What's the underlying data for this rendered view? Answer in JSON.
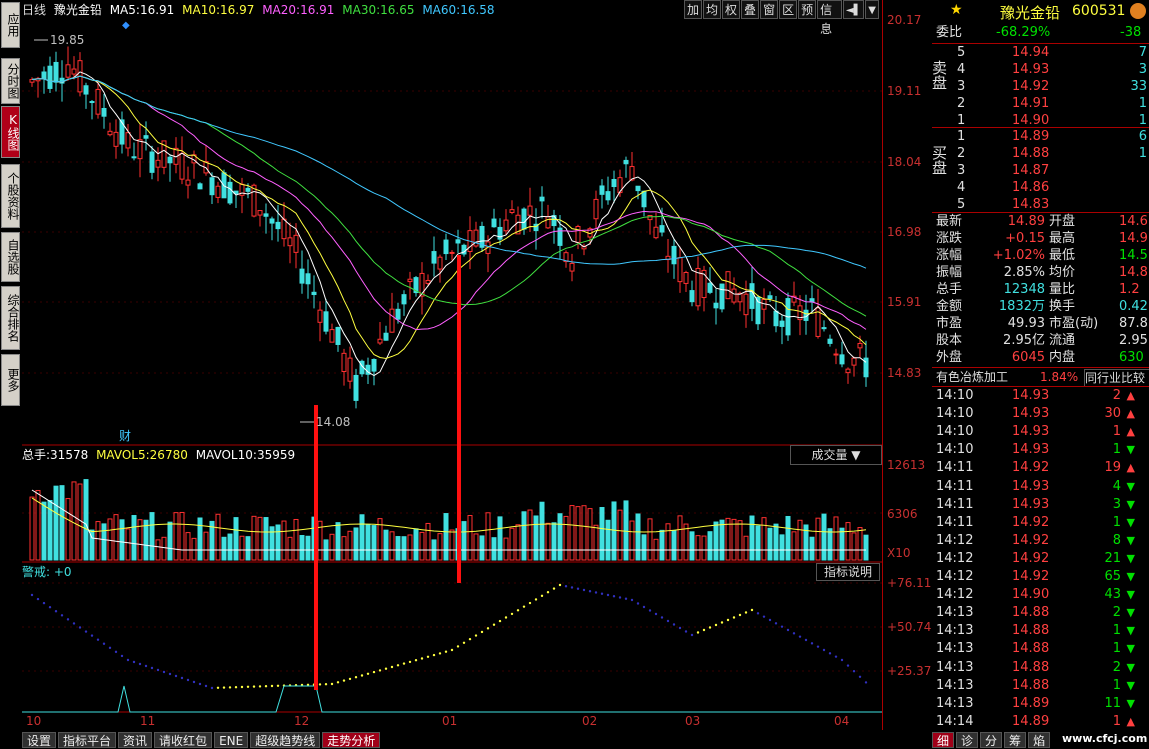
{
  "left_tabs": [
    "应用",
    "分时图",
    "K线图",
    "个股资料",
    "自选股",
    "综合排名",
    "更多"
  ],
  "header": {
    "period": "日线",
    "stock_name": "豫光金铅",
    "ma": [
      {
        "label": "MA5:",
        "value": "16.91",
        "color": "#ffffff"
      },
      {
        "label": "MA10:",
        "value": "16.97",
        "color": "#ffff40"
      },
      {
        "label": "MA20:",
        "value": "16.91",
        "color": "#ff60ff"
      },
      {
        "label": "MA30:",
        "value": "16.65",
        "color": "#40e040"
      },
      {
        "label": "MA60:",
        "value": "16.58",
        "color": "#40c8ff"
      }
    ]
  },
  "toolbar": [
    "加",
    "均",
    "权",
    "叠",
    "窗",
    "区",
    "预",
    "信息",
    "◄▌",
    "▼"
  ],
  "price_axis": [
    "20.17",
    "19.11",
    "18.04",
    "16.98",
    "15.91",
    "14.83"
  ],
  "price_annotations": {
    "high": "19.85",
    "low": "14.08",
    "event": "财"
  },
  "volume_axis": [
    "12613",
    "6306",
    "X10"
  ],
  "volume_header": {
    "total_label": "总手:",
    "total": "31578",
    "mavol5_label": "MAVOL5:",
    "mavol5": "26780",
    "mavol10_label": "MAVOL10:",
    "mavol10": "35959"
  },
  "volume_selector": "成交量 ▼",
  "indicator_header": "警戒: +0",
  "indicator_button": "指标说明",
  "indicator_axis": [
    "+76.11",
    "+50.74",
    "+25.37"
  ],
  "x_axis": [
    "10",
    "11",
    "12",
    "01",
    "02",
    "03",
    "04"
  ],
  "bottom_tabs": [
    "设置",
    "指标平台",
    "资讯",
    "请收红包",
    "ENE",
    "超级趋势线",
    "走势分析"
  ],
  "right_panel": {
    "title_name": "豫光金铅",
    "title_code": "600531",
    "webi_ratio_label": "委比",
    "webi_ratio": "-68.29%",
    "webi_diff": "-38",
    "sell_label": "卖盘",
    "buy_label": "买盘",
    "sell": [
      {
        "n": "5",
        "price": "14.94",
        "vol": "7"
      },
      {
        "n": "4",
        "price": "14.93",
        "vol": "3"
      },
      {
        "n": "3",
        "price": "14.92",
        "vol": "33"
      },
      {
        "n": "2",
        "price": "14.91",
        "vol": "1"
      },
      {
        "n": "1",
        "price": "14.90",
        "vol": "1"
      }
    ],
    "buy": [
      {
        "n": "1",
        "price": "14.89",
        "vol": "6"
      },
      {
        "n": "2",
        "price": "14.88",
        "vol": "1"
      },
      {
        "n": "3",
        "price": "14.87",
        "vol": ""
      },
      {
        "n": "4",
        "price": "14.86",
        "vol": ""
      },
      {
        "n": "5",
        "price": "14.83",
        "vol": ""
      }
    ],
    "quotes": [
      {
        "l1": "最新",
        "v1": "14.89",
        "l2": "开盘",
        "v2": "14.6"
      },
      {
        "l1": "涨跌",
        "v1": "+0.15",
        "l2": "最高",
        "v2": "14.9"
      },
      {
        "l1": "涨幅",
        "v1": "+1.02%",
        "l2": "最低",
        "v2": "14.5"
      },
      {
        "l1": "振幅",
        "v1": "2.85%",
        "l2": "均价",
        "v2": "14.8"
      },
      {
        "l1": "总手",
        "v1": "12348",
        "l2": "量比",
        "v2": "1.2"
      },
      {
        "l1": "金额",
        "v1": "1832万",
        "l2": "换手",
        "v2": "0.42"
      },
      {
        "l1": "市盈",
        "v1": "49.93",
        "l2": "市盈(动)",
        "v2": "87.8"
      },
      {
        "l1": "股本",
        "v1": "2.95亿",
        "l2": "流通",
        "v2": "2.95"
      },
      {
        "l1": "外盘",
        "v1": "6045",
        "l2": "内盘",
        "v2": "630"
      }
    ],
    "industry": "有色冶炼加工",
    "industry_pct": "1.84%",
    "industry_btn": "同行业比较",
    "ticks": [
      {
        "t": "14:10",
        "p": "14.93",
        "v": "2",
        "d": "up"
      },
      {
        "t": "14:10",
        "p": "14.93",
        "v": "30",
        "d": "up"
      },
      {
        "t": "14:10",
        "p": "14.93",
        "v": "1",
        "d": "up"
      },
      {
        "t": "14:10",
        "p": "14.93",
        "v": "1",
        "d": "down"
      },
      {
        "t": "14:11",
        "p": "14.92",
        "v": "19",
        "d": "up"
      },
      {
        "t": "14:11",
        "p": "14.93",
        "v": "4",
        "d": "down"
      },
      {
        "t": "14:11",
        "p": "14.93",
        "v": "3",
        "d": "down"
      },
      {
        "t": "14:11",
        "p": "14.92",
        "v": "1",
        "d": "down"
      },
      {
        "t": "14:12",
        "p": "14.92",
        "v": "8",
        "d": "down"
      },
      {
        "t": "14:12",
        "p": "14.92",
        "v": "21",
        "d": "down"
      },
      {
        "t": "14:12",
        "p": "14.92",
        "v": "65",
        "d": "down"
      },
      {
        "t": "14:12",
        "p": "14.90",
        "v": "43",
        "d": "down"
      },
      {
        "t": "14:13",
        "p": "14.88",
        "v": "2",
        "d": "down"
      },
      {
        "t": "14:13",
        "p": "14.88",
        "v": "1",
        "d": "down"
      },
      {
        "t": "14:13",
        "p": "14.88",
        "v": "1",
        "d": "down"
      },
      {
        "t": "14:13",
        "p": "14.88",
        "v": "2",
        "d": "down"
      },
      {
        "t": "14:13",
        "p": "14.88",
        "v": "1",
        "d": "down"
      },
      {
        "t": "14:13",
        "p": "14.89",
        "v": "11",
        "d": "down"
      },
      {
        "t": "14:14",
        "p": "14.89",
        "v": "1",
        "d": "up"
      }
    ],
    "bottom_tabs": [
      "细",
      "诊",
      "分",
      "筹",
      "焰"
    ],
    "watermark": "www.cfcj.com"
  }
}
